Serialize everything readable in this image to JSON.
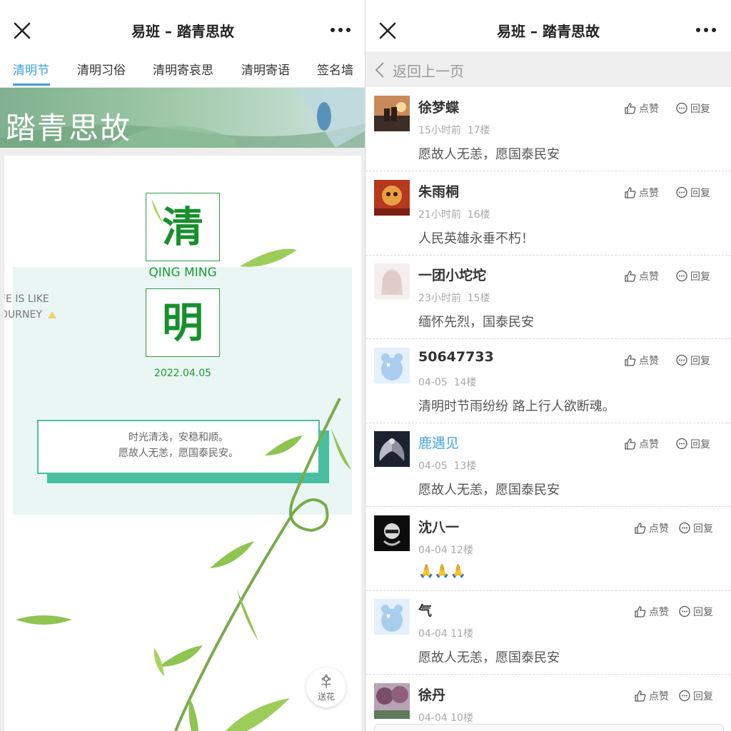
{
  "left": {
    "title": "易班 – 踏青思故",
    "tabs": [
      "清明节",
      "清明习俗",
      "清明寄哀思",
      "清明寄语",
      "签名墙"
    ],
    "banner_title": "踏青思故",
    "card": {
      "char1": "清",
      "subtitle": "QING MING",
      "char2": "明",
      "date": "2022.04.05",
      "side_line1": "FE IS LIKE",
      "side_line2": "OURNEY",
      "message_line1": "时光清浅，安稳和顺。",
      "message_line2": "愿故人无恙，愿国泰民安。"
    },
    "flower_label": "送花",
    "colors": {
      "accent": "#3b9ee0",
      "green": "#17902c",
      "teal": "#48c0a0"
    }
  },
  "right": {
    "title": "易班 – 踏青思故",
    "back_label": "返回上一页",
    "like_label": "点赞",
    "reply_label": "回复",
    "comments": [
      {
        "name": "徐梦蝶",
        "time": "15小时前",
        "floor": "17楼",
        "text": "愿故人无恙，愿国泰民安",
        "name_color": "default",
        "avatar": "sunset-photo"
      },
      {
        "name": "朱雨桐",
        "time": "21小时前",
        "floor": "16楼",
        "text": "人民英雄永垂不朽！",
        "name_color": "default",
        "avatar": "cartoon-photo"
      },
      {
        "name": "一团小坨坨",
        "time": "23小时前",
        "floor": "15楼",
        "text": "缅怀先烈，国泰民安",
        "name_color": "default",
        "avatar": "anime-photo"
      },
      {
        "name": "50647733",
        "time": "04-05",
        "floor": "14楼",
        "text": "清明时节雨纷纷 路上行人欲断魂。",
        "name_color": "default",
        "avatar": "default-bear"
      },
      {
        "name": "鹿遇见",
        "time": "04-05",
        "floor": "13楼",
        "text": "愿故人无恙，愿国泰民安",
        "name_color": "blue",
        "avatar": "angel-photo"
      },
      {
        "name": "沈八一",
        "time": "04-04",
        "floor": "12楼",
        "text": "🙏🙏🙏",
        "name_color": "default",
        "avatar": "dark-photo"
      },
      {
        "name": "气",
        "time": "04-04",
        "floor": "11楼",
        "text": "愿故人无恙，愿国泰民安",
        "name_color": "default",
        "avatar": "default-bear"
      },
      {
        "name": "徐丹",
        "time": "04-04",
        "floor": "10楼",
        "text": "",
        "name_color": "default",
        "avatar": "tree-photo"
      }
    ]
  }
}
